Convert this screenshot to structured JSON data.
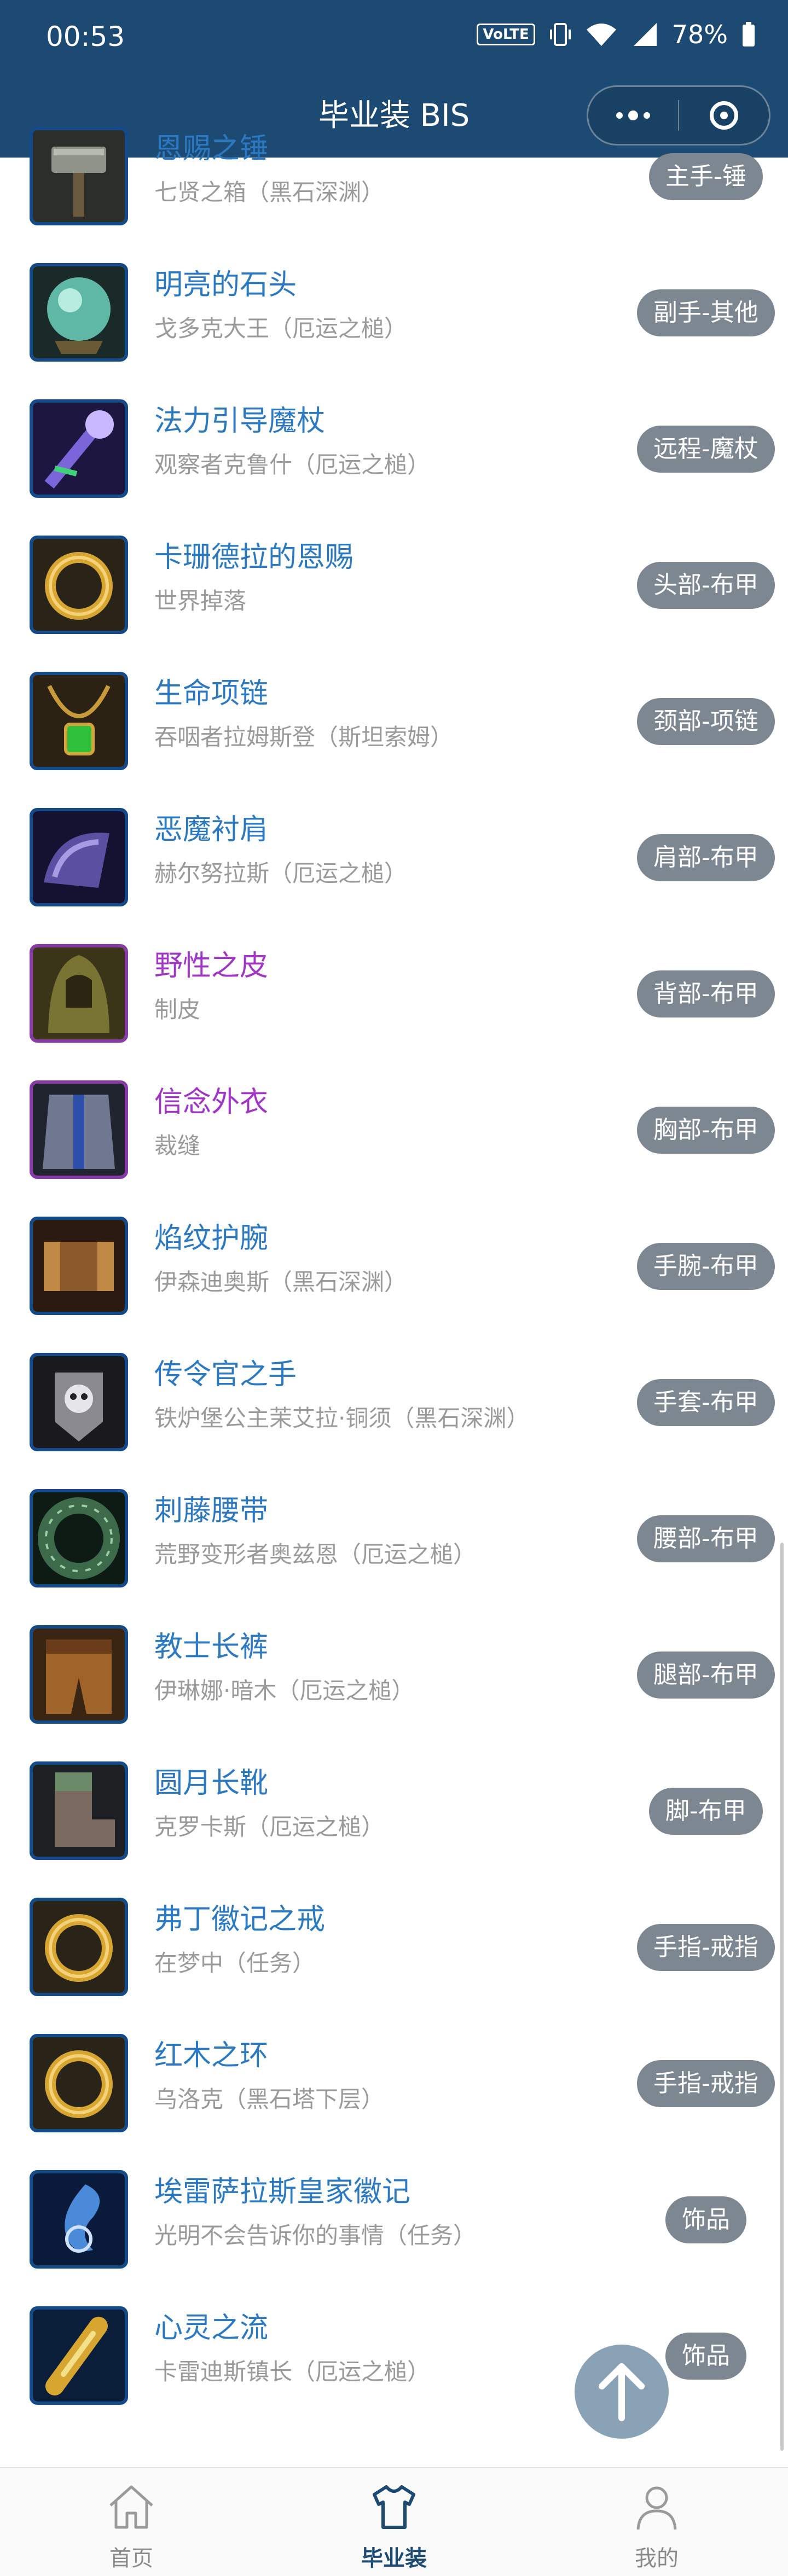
{
  "status_bar": {
    "time": "00:53",
    "volte": "VoLTE",
    "battery": "78%"
  },
  "header": {
    "title": "毕业装 BIS",
    "menu_icon": "more-dots-icon",
    "close_icon": "mini-program-close-icon"
  },
  "items": [
    {
      "name": "恩赐之锤",
      "source": "七贤之箱（黑石深渊）",
      "slot": "主手-锤",
      "quality": "rare",
      "icon": "hammer-icon"
    },
    {
      "name": "明亮的石头",
      "source": "戈多克大王（厄运之槌）",
      "slot": "副手-其他",
      "quality": "rare",
      "icon": "orb-icon"
    },
    {
      "name": "法力引导魔杖",
      "source": "观察者克鲁什（厄运之槌）",
      "slot": "远程-魔杖",
      "quality": "rare",
      "icon": "wand-icon"
    },
    {
      "name": "卡珊德拉的恩赐",
      "source": "世界掉落",
      "slot": "头部-布甲",
      "quality": "rare",
      "icon": "ring-icon"
    },
    {
      "name": "生命项链",
      "source": "吞咽者拉姆斯登（斯坦索姆）",
      "slot": "颈部-项链",
      "quality": "rare",
      "icon": "necklace-icon"
    },
    {
      "name": "恶魔衬肩",
      "source": "赫尔努拉斯（厄运之槌）",
      "slot": "肩部-布甲",
      "quality": "rare",
      "icon": "shoulder-icon"
    },
    {
      "name": "野性之皮",
      "source": "制皮",
      "slot": "背部-布甲",
      "quality": "epic",
      "icon": "cloak-icon"
    },
    {
      "name": "信念外衣",
      "source": "裁缝",
      "slot": "胸部-布甲",
      "quality": "epic",
      "icon": "robe-icon"
    },
    {
      "name": "焰纹护腕",
      "source": "伊森迪奥斯（黑石深渊）",
      "slot": "手腕-布甲",
      "quality": "rare",
      "icon": "bracer-icon"
    },
    {
      "name": "传令官之手",
      "source": "铁炉堡公主茉艾拉·铜须（黑石深渊）",
      "slot": "手套-布甲",
      "quality": "rare",
      "icon": "gauntlet-icon"
    },
    {
      "name": "刺藤腰带",
      "source": "荒野变形者奥兹恩（厄运之槌）",
      "slot": "腰部-布甲",
      "quality": "rare",
      "icon": "belt-icon"
    },
    {
      "name": "教士长裤",
      "source": "伊琳娜·暗木（厄运之槌）",
      "slot": "腿部-布甲",
      "quality": "rare",
      "icon": "pants-icon"
    },
    {
      "name": "圆月长靴",
      "source": "克罗卡斯（厄运之槌）",
      "slot": "脚-布甲",
      "quality": "rare",
      "icon": "boots-icon"
    },
    {
      "name": "弗丁徽记之戒",
      "source": "在梦中（任务）",
      "slot": "手指-戒指",
      "quality": "rare",
      "icon": "ring-icon"
    },
    {
      "name": "红木之环",
      "source": "乌洛克（黑石塔下层）",
      "slot": "手指-戒指",
      "quality": "rare",
      "icon": "ring-icon"
    },
    {
      "name": "埃雷萨拉斯皇家徽记",
      "source": "光明不会告诉你的事情（任务）",
      "slot": "饰品",
      "quality": "rare",
      "icon": "seal-icon"
    },
    {
      "name": "心灵之流",
      "source": "卡雷迪斯镇长（厄运之槌）",
      "slot": "饰品",
      "quality": "rare",
      "icon": "vial-icon"
    }
  ],
  "tabs": [
    {
      "label": "首页",
      "icon": "home-icon",
      "active": false
    },
    {
      "label": "毕业装",
      "icon": "shirt-icon",
      "active": true
    },
    {
      "label": "我的",
      "icon": "user-icon",
      "active": false
    }
  ],
  "back_to_top_icon": "arrow-up-icon",
  "colors": {
    "header_bg": "#1d4a72",
    "rare_text": "#2a79c2",
    "epic_text": "#a235c8",
    "badge_bg": "#7d8791"
  }
}
